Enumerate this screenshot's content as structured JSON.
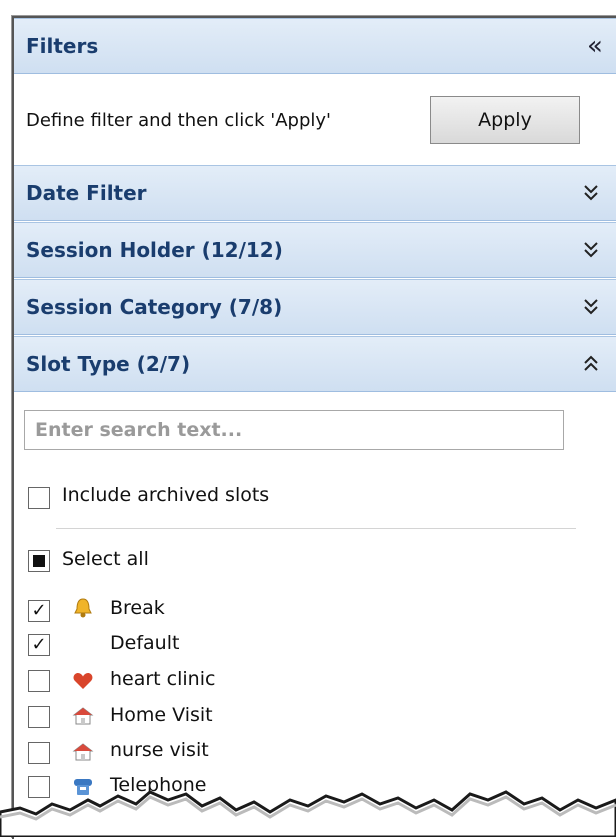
{
  "filters": {
    "title": "Filters",
    "collapse_icon": "double-chevron-left-icon",
    "intro_text": "Define filter and then click 'Apply'",
    "apply_label": "Apply"
  },
  "sections": [
    {
      "label": "Date Filter",
      "expanded": false
    },
    {
      "label": "Session Holder (12/12)",
      "expanded": false
    },
    {
      "label": "Session Category (7/8)",
      "expanded": false
    },
    {
      "label": "Slot Type (2/7)",
      "expanded": true
    }
  ],
  "slot_type": {
    "search_placeholder": "Enter search text...",
    "include_archived_label": "Include archived slots",
    "include_archived_checked": false,
    "select_all_label": "Select all",
    "select_all_state": "indeterminate",
    "items": [
      {
        "label": "Break",
        "checked": true,
        "icon": "bell-icon"
      },
      {
        "label": "Default",
        "checked": true,
        "icon": ""
      },
      {
        "label": "heart clinic",
        "checked": false,
        "icon": "heart-icon"
      },
      {
        "label": "Home Visit",
        "checked": false,
        "icon": "house-icon"
      },
      {
        "label": "nurse visit",
        "checked": false,
        "icon": "house-icon"
      },
      {
        "label": "Telephone",
        "checked": false,
        "icon": "telephone-icon"
      }
    ]
  },
  "colors": {
    "header_text": "#1a3d6e",
    "header_bg": "#cfdff1",
    "header_border": "#9fbde0"
  }
}
